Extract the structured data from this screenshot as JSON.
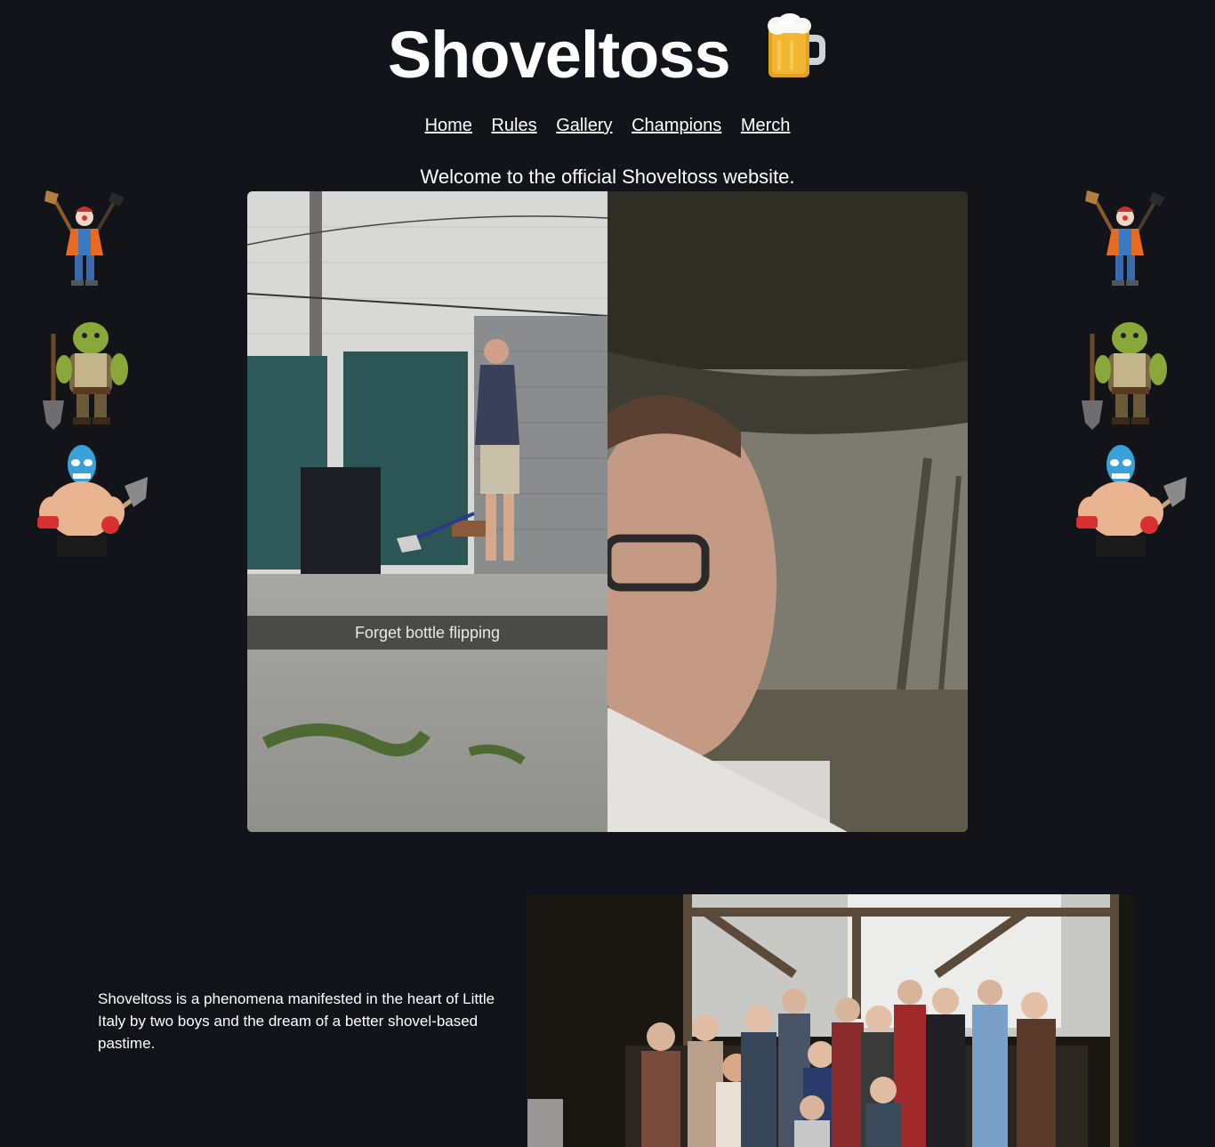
{
  "header": {
    "title": "Shoveltoss",
    "title_icon": "beer-mug-icon"
  },
  "nav": {
    "items": [
      {
        "label": "Home"
      },
      {
        "label": "Rules"
      },
      {
        "label": "Gallery"
      },
      {
        "label": "Champions"
      },
      {
        "label": "Merch"
      }
    ]
  },
  "hero": {
    "welcome_text": "Welcome to the official Shoveltoss website.",
    "video_caption": "Forget bottle flipping"
  },
  "side_figures": {
    "left": [
      "clown-with-shovel-icon",
      "ogre-with-shovel-icon",
      "luchador-with-shovel-icon"
    ],
    "right": [
      "clown-with-shovel-icon",
      "ogre-with-shovel-icon",
      "luchador-with-shovel-icon"
    ]
  },
  "about": {
    "text": "Shoveltoss is a phenomena manifested in the heart of Little Italy by two boys and the dream of a better shovel-based pastime."
  },
  "colors": {
    "background": "#12141a",
    "text": "#ffffff"
  }
}
